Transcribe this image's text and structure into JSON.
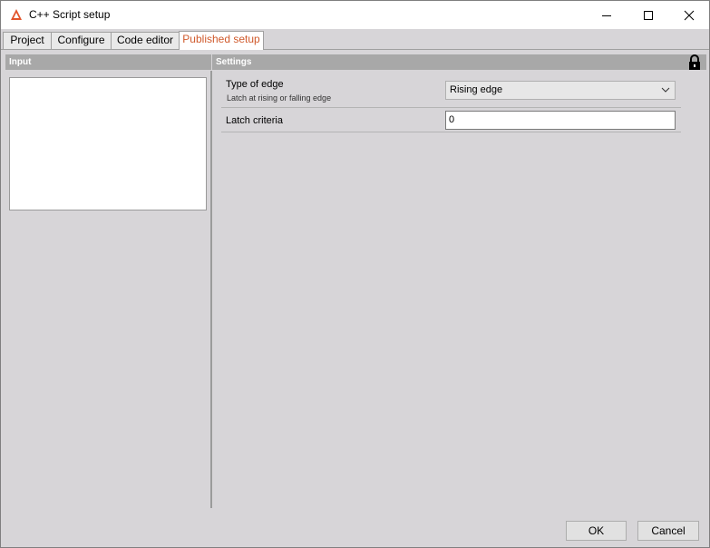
{
  "window": {
    "title": "C++ Script setup"
  },
  "tabs": [
    {
      "label": "Project"
    },
    {
      "label": "Configure"
    },
    {
      "label": "Code editor"
    },
    {
      "label": "Published setup"
    }
  ],
  "active_tab": "Published setup",
  "panels": {
    "input_header": "Input",
    "settings_header": "Settings"
  },
  "settings": {
    "edge_type": {
      "label": "Type of edge",
      "description": "Latch at rising or falling edge",
      "value": "Rising edge"
    },
    "latch_criteria": {
      "label": "Latch criteria",
      "value": "0"
    }
  },
  "footer": {
    "ok_label": "OK",
    "cancel_label": "Cancel"
  },
  "colors": {
    "accent": "#d05a2c",
    "header_bg": "#a8a8a8",
    "window_bg": "#d7d5d8"
  },
  "icons": [
    "app-logo-icon",
    "minimize-icon",
    "maximize-icon",
    "close-icon",
    "lock-icon",
    "chevron-down-icon"
  ]
}
